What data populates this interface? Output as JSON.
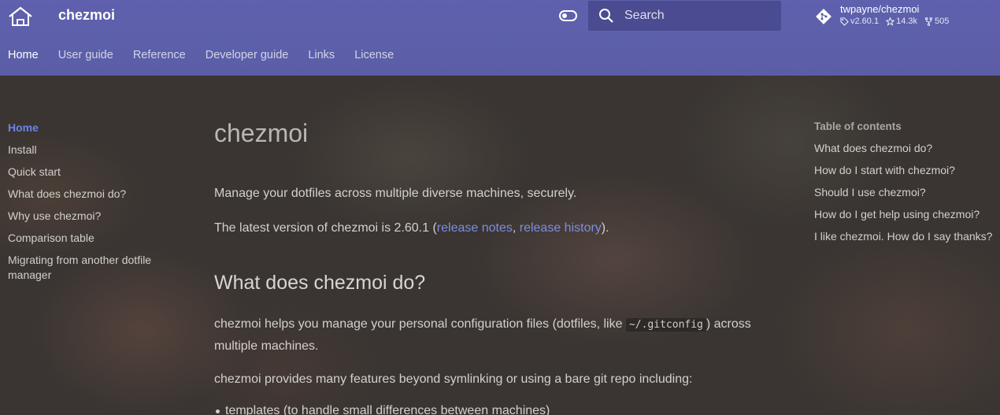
{
  "header": {
    "site_title": "chezmoi",
    "search_placeholder": "Search",
    "repo": {
      "name": "twpayne/chezmoi",
      "version": "v2.60.1",
      "stars": "14.3k",
      "forks": "505"
    }
  },
  "tabs": [
    {
      "label": "Home"
    },
    {
      "label": "User guide"
    },
    {
      "label": "Reference"
    },
    {
      "label": "Developer guide"
    },
    {
      "label": "Links"
    },
    {
      "label": "License"
    }
  ],
  "left_nav": [
    {
      "label": "Home"
    },
    {
      "label": "Install"
    },
    {
      "label": "Quick start"
    },
    {
      "label": "What does chezmoi do?"
    },
    {
      "label": "Why use chezmoi?"
    },
    {
      "label": "Comparison table"
    },
    {
      "label": "Migrating from another dotfile manager"
    }
  ],
  "content": {
    "title": "chezmoi",
    "intro": "Manage your dotfiles across multiple diverse machines, securely.",
    "version_prefix": "The latest version of chezmoi is 2.60.1 (",
    "release_notes": "release notes",
    "comma": ", ",
    "release_history": "release history",
    "version_suffix": ").",
    "h2": "What does chezmoi do?",
    "helps_prefix": "chezmoi helps you manage your personal configuration files (dotfiles, like ",
    "helps_code": "~/.gitconfig",
    "helps_suffix": ") across multiple machines.",
    "features": "chezmoi provides many features beyond symlinking or using a bare git repo including:",
    "bullet_1": "templates (to handle small differences between machines)"
  },
  "toc": {
    "title": "Table of contents",
    "items": [
      {
        "label": "What does chezmoi do?"
      },
      {
        "label": "How do I start with chezmoi?"
      },
      {
        "label": "Should I use chezmoi?"
      },
      {
        "label": "How do I get help using chezmoi?"
      },
      {
        "label": "I like chezmoi. How do I say thanks?"
      }
    ]
  },
  "colors": {
    "header_bg": "#5b5ea6",
    "accent_link": "#7d8de0",
    "active_nav": "#6c82e8"
  }
}
